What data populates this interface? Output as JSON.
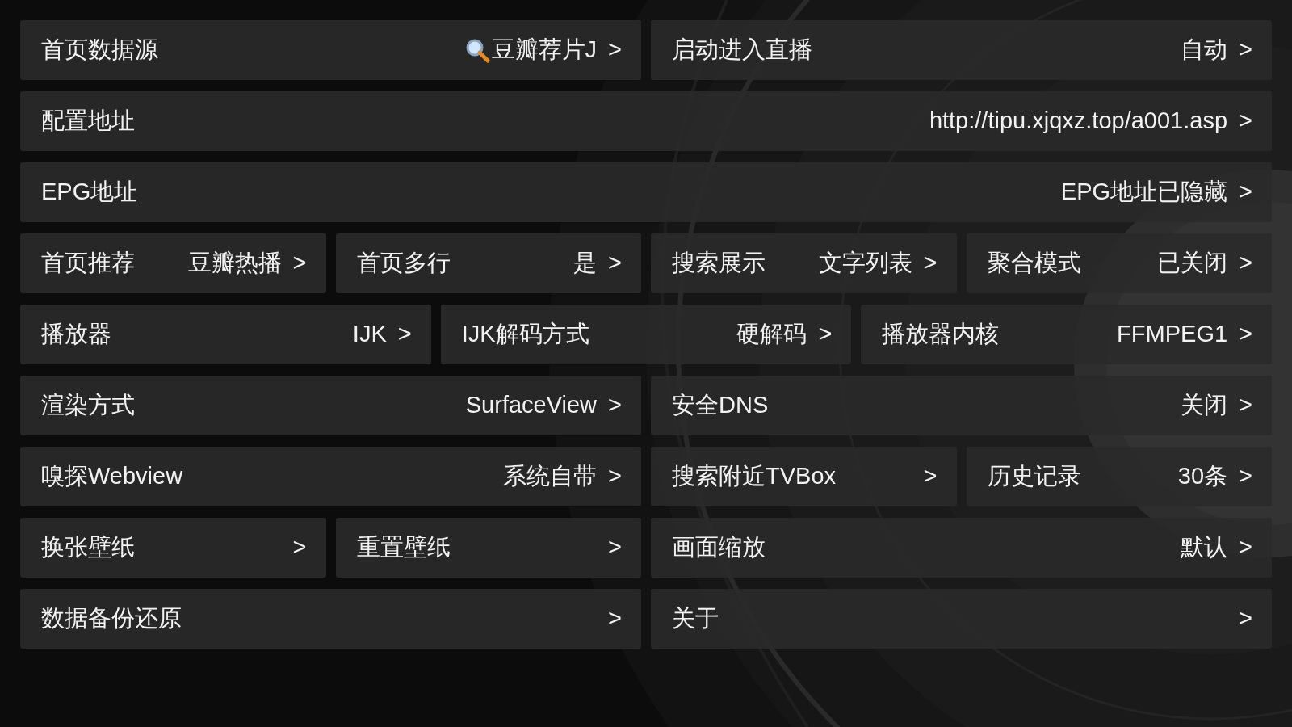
{
  "rows": [
    [
      [
        {
          "label": "首页数据源",
          "value": "豆瓣荐片J",
          "value_icon": true,
          "arrow": ">"
        }
      ],
      [
        {
          "label": "启动进入直播",
          "value": "自动",
          "arrow": ">"
        }
      ]
    ],
    [
      [
        {
          "label": "配置地址",
          "value": "http://tipu.xjqxz.top/a001.asp",
          "arrow": ">"
        }
      ]
    ],
    [
      [
        {
          "label": "EPG地址",
          "value": "EPG地址已隐藏",
          "arrow": ">"
        }
      ]
    ],
    [
      [
        {
          "label": "首页推荐",
          "value": "豆瓣热播",
          "arrow": ">"
        },
        {
          "label": "首页多行",
          "value": "是",
          "arrow": ">"
        }
      ],
      [
        {
          "label": "搜索展示",
          "value": "文字列表",
          "arrow": ">"
        },
        {
          "label": "聚合模式",
          "value": "已关闭",
          "arrow": ">"
        }
      ]
    ],
    [
      [
        {
          "label": "播放器",
          "value": "IJK",
          "arrow": ">"
        },
        {
          "label": "IJK解码方式",
          "value": "硬解码",
          "arrow": ">"
        },
        {
          "label": "播放器内核",
          "value": "FFMPEG1",
          "arrow": ">"
        }
      ]
    ],
    [
      [
        {
          "label": "渲染方式",
          "value": "SurfaceView",
          "arrow": ">"
        }
      ],
      [
        {
          "label": "安全DNS",
          "value": "关闭",
          "arrow": ">"
        }
      ]
    ],
    [
      [
        {
          "label": "嗅探Webview",
          "value": "系统自带",
          "arrow": ">"
        }
      ],
      [
        {
          "label": "搜索附近TVBox",
          "arrow": ">"
        },
        {
          "label": "历史记录",
          "value": "30条",
          "arrow": ">"
        }
      ]
    ],
    [
      [
        {
          "label": "换张壁纸",
          "arrow": ">"
        },
        {
          "label": "重置壁纸",
          "arrow": ">"
        }
      ],
      [
        {
          "label": "画面缩放",
          "value": "默认",
          "arrow": ">"
        }
      ]
    ],
    [
      [
        {
          "label": "数据备份还原",
          "arrow": ">"
        }
      ],
      [
        {
          "label": "关于",
          "arrow": ">"
        }
      ]
    ]
  ]
}
